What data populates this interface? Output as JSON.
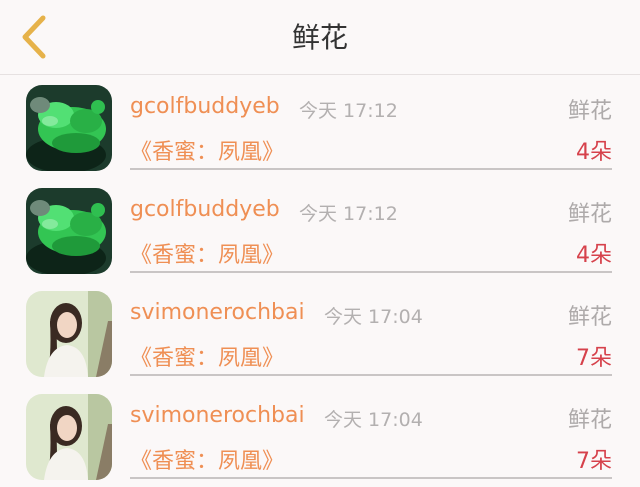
{
  "header": {
    "title": "鲜花"
  },
  "items": [
    {
      "username": "gcolfbuddyeb",
      "time": "今天 17:12",
      "type": "鲜花",
      "gift": "《香蜜：夙凰》",
      "count": "4朵"
    },
    {
      "username": "gcolfbuddyeb",
      "time": "今天 17:12",
      "type": "鲜花",
      "gift": "《香蜜：夙凰》",
      "count": "4朵"
    },
    {
      "username": "svimonerochbai",
      "time": "今天 17:04",
      "type": "鲜花",
      "gift": "《香蜜：夙凰》",
      "count": "7朵"
    },
    {
      "username": "svimonerochbai",
      "time": "今天 17:04",
      "type": "鲜花",
      "gift": "《香蜜：夙凰》",
      "count": "7朵"
    }
  ],
  "colors": {
    "accent_orange": "#ef8f54",
    "count_red": "#d6414b",
    "back_arrow": "#e6b24a"
  }
}
